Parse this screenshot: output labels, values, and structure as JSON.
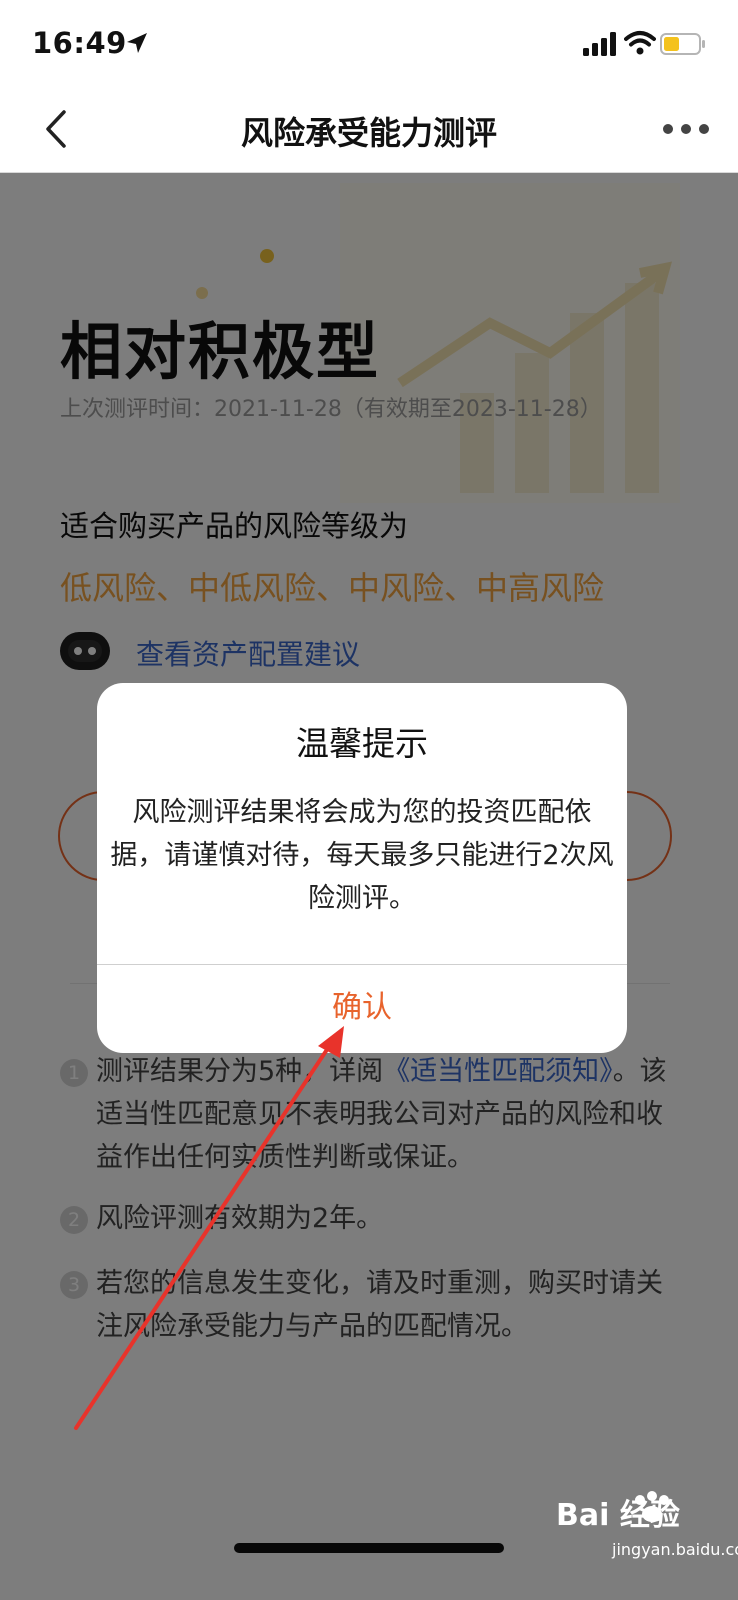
{
  "status": {
    "time": "16:49"
  },
  "nav": {
    "title": "风险承受能力测评"
  },
  "result": {
    "title": "相对积极型",
    "eval_time": "上次测评时间：2021-11-28（有效期至2023-11-28）",
    "suit_heading": "适合购买产品的风险等级为",
    "risk_levels": "低风险、中低风险、中风险、中高风险",
    "asset_link": "查看资产配置建议"
  },
  "notes": [
    {
      "num": "1",
      "pre": "测评结果分为5种，详阅",
      "link": "《适当性匹配须知》",
      "post": "。该适当性匹配意见不表明我公司对产品的风险和收益作出任何实质性判断或保证。"
    },
    {
      "num": "2",
      "text": "风险评测有效期为2年。"
    },
    {
      "num": "3",
      "text": "若您的信息发生变化，请及时重测，购买时请关注风险承受能力与产品的匹配情况。"
    }
  ],
  "dialog": {
    "title": "温馨提示",
    "message": "风险测评结果将会成为您的投资匹配依据，请谨慎对待，每天最多只能进行2次风险测评。",
    "confirm": "确认"
  },
  "watermark": {
    "text": "Bai 经验",
    "sub": "jingyan.baidu.com"
  },
  "colors": {
    "accent": "#e8632c",
    "link": "#3b66c8",
    "risk": "#f0a340"
  }
}
